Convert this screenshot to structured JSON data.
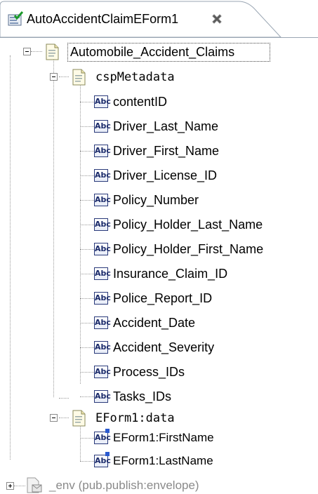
{
  "tab": {
    "title": "AutoAccidentClaimEForm1",
    "icon": "form-editor-icon",
    "close_icon": "close-icon"
  },
  "tree": {
    "root": {
      "label": "Automobile_Accident_Claims",
      "icon": "document-icon",
      "expanded": true
    },
    "metadata": {
      "label": "cspMetadata",
      "icon": "document-icon",
      "expanded": true,
      "fields": [
        "contentID",
        "Driver_Last_Name",
        "Driver_First_Name",
        "Driver_License_ID",
        "Policy_Number",
        "Policy_Holder_Last_Name",
        "Policy_Holder_First_Name",
        "Insurance_Claim_ID",
        "Police_Report_ID",
        "Accident_Date",
        "Accident_Severity",
        "Process_IDs",
        "Tasks_IDs"
      ],
      "field_icon": "string-field-icon",
      "field_icon_text": "Abc"
    },
    "eform_data": {
      "label": "EForm1:data",
      "icon": "document-icon",
      "expanded": true,
      "fields": [
        "EForm1:FirstName",
        "EForm1:LastName"
      ],
      "field_icon": "string-field-icon"
    },
    "env": {
      "label": "_env (pub.publish:envelope)",
      "icon": "envelope-document-icon",
      "expanded": false
    }
  }
}
